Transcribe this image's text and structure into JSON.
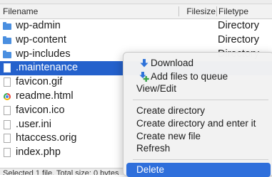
{
  "columns": {
    "filename": "Filename",
    "filesize": "Filesize",
    "filetype": "Filetype"
  },
  "files": [
    {
      "name": "wp-admin",
      "type": "Directory",
      "icon": "folder-icon",
      "selected": false
    },
    {
      "name": "wp-content",
      "type": "Directory",
      "icon": "folder-icon",
      "selected": false
    },
    {
      "name": "wp-includes",
      "type": "Directory",
      "icon": "folder-icon",
      "selected": false
    },
    {
      "name": ".maintenance",
      "type": "",
      "icon": "file-icon",
      "selected": true
    },
    {
      "name": "favicon.gif",
      "type": "",
      "icon": "file-icon",
      "selected": false
    },
    {
      "name": "readme.html",
      "type": "",
      "icon": "html-file-icon",
      "selected": false
    },
    {
      "name": "favicon.ico",
      "type": "",
      "icon": "file-icon",
      "selected": false
    },
    {
      "name": ".user.ini",
      "type": "",
      "icon": "file-icon",
      "selected": false
    },
    {
      "name": "htaccess.orig",
      "type": "",
      "icon": "file-icon",
      "selected": false
    },
    {
      "name": "index.php",
      "type": "",
      "icon": "file-icon",
      "selected": false
    }
  ],
  "status_bar": {
    "text": "Selected 1 file. Total size: 0 bytes"
  },
  "context_menu": {
    "download": "Download",
    "add_to_queue": "Add files to queue",
    "view_edit": "View/Edit",
    "create_directory": "Create directory",
    "create_directory_enter": "Create directory and enter it",
    "create_new_file": "Create new file",
    "refresh": "Refresh",
    "delete": "Delete"
  },
  "colors": {
    "selection": "#2461cc",
    "menu_highlight": "#2f6fdb",
    "folder": "#4a8fe0",
    "download_icon": "#2f73d9",
    "add_icon": "#3aa24a"
  }
}
